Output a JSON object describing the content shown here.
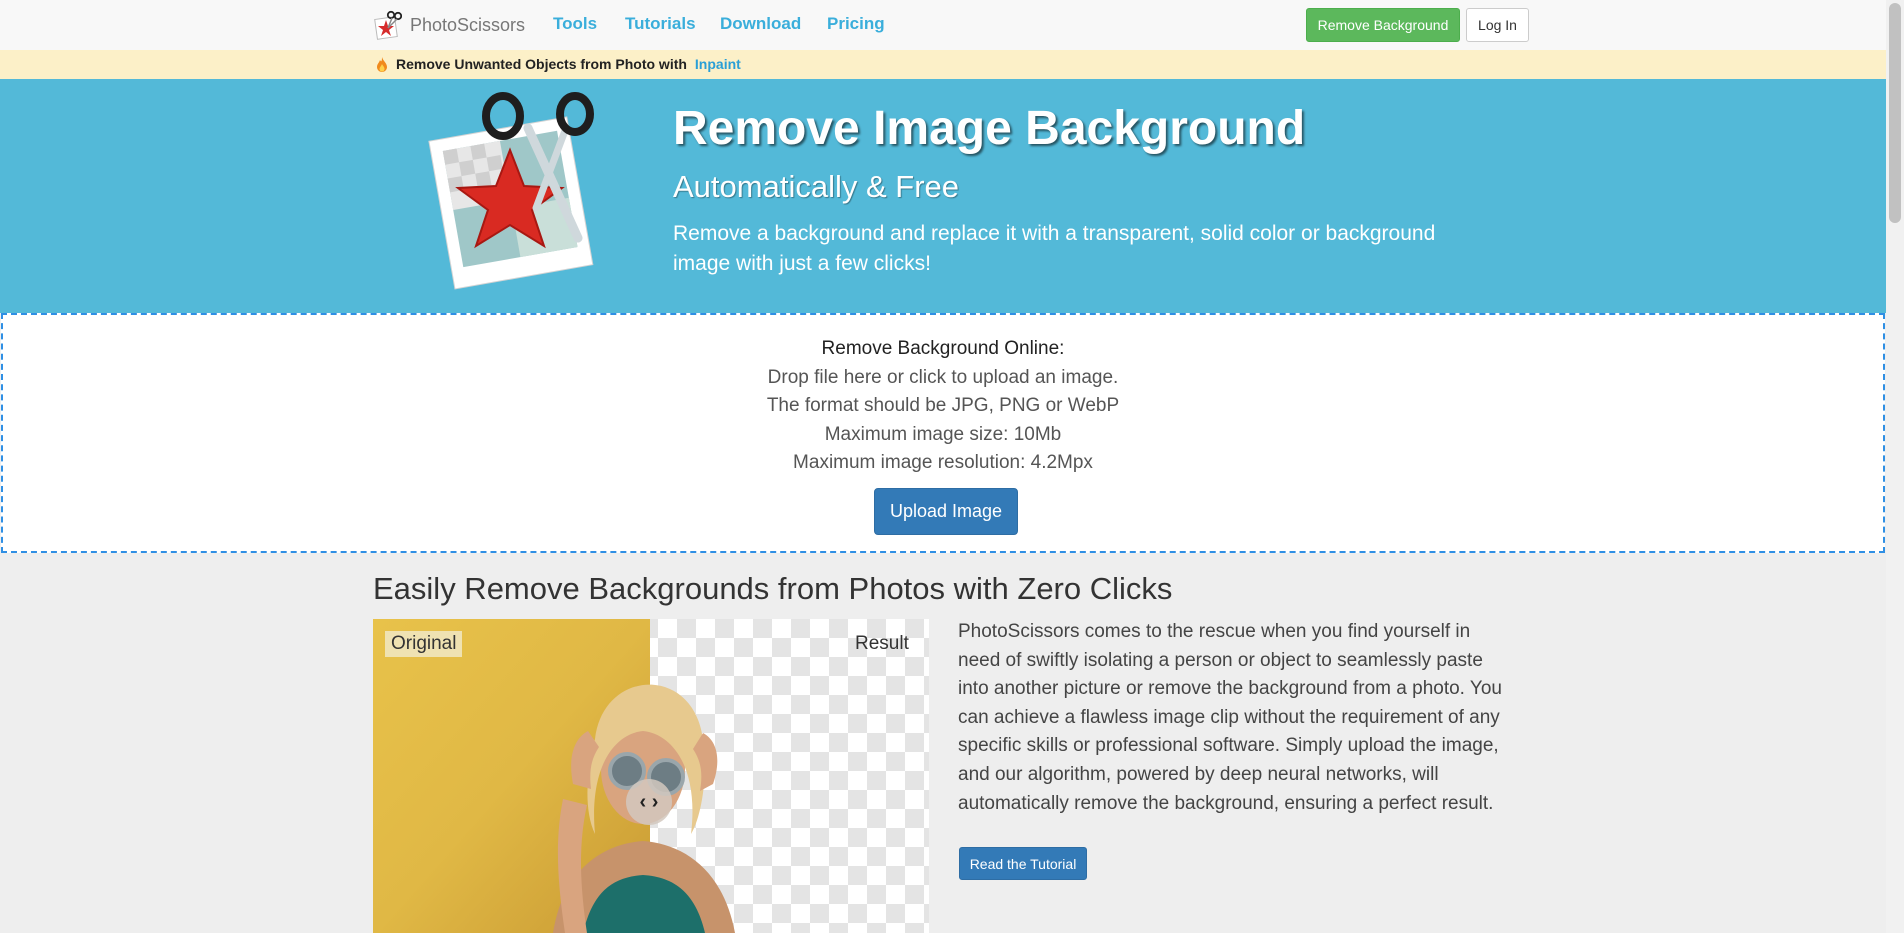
{
  "nav": {
    "brand": "PhotoScissors",
    "links": [
      "Tools",
      "Tutorials",
      "Download",
      "Pricing"
    ],
    "remove_bg_button": "Remove Background",
    "login_button": "Log In"
  },
  "promo": {
    "text": "Remove Unwanted Objects from Photo with",
    "link": "Inpaint",
    "icon": "flame-icon"
  },
  "hero": {
    "title": "Remove Image Background",
    "subtitle": "Automatically & Free",
    "description": "Remove a background and replace it with a transparent, solid color or background image with just a few clicks!",
    "logo": "photo-scissors-logo"
  },
  "upload": {
    "heading": "Remove Background Online:",
    "lines": [
      "Drop file here or click to upload an image.",
      "The format should be JPG, PNG or WebP",
      "Maximum image size: 10Mb",
      "Maximum image resolution: 4.2Mpx"
    ],
    "button": "Upload Image"
  },
  "section": {
    "title": "Easily Remove Backgrounds from Photos with Zero Clicks",
    "original_label": "Original",
    "result_label": "Result",
    "slider_glyph": "‹ ›",
    "description": "PhotoScissors comes to the rescue when you find yourself in need of swiftly isolating a person or object to seamlessly paste into another picture or remove the background from a photo. You can achieve a flawless image clip without the requirement of any specific skills or professional software. Simply upload the image, and our algorithm, powered by deep neural networks, will automatically remove the background, ensuring a perfect result.",
    "tutorial_button": "Read the Tutorial"
  },
  "colors": {
    "hero_bg": "#53b9d8",
    "promo_bg": "#fcf0c8",
    "nav_link": "#3aaedb",
    "primary_button": "#337ab7",
    "success_button": "#5cb85c",
    "upload_border": "#2f8fe4"
  }
}
